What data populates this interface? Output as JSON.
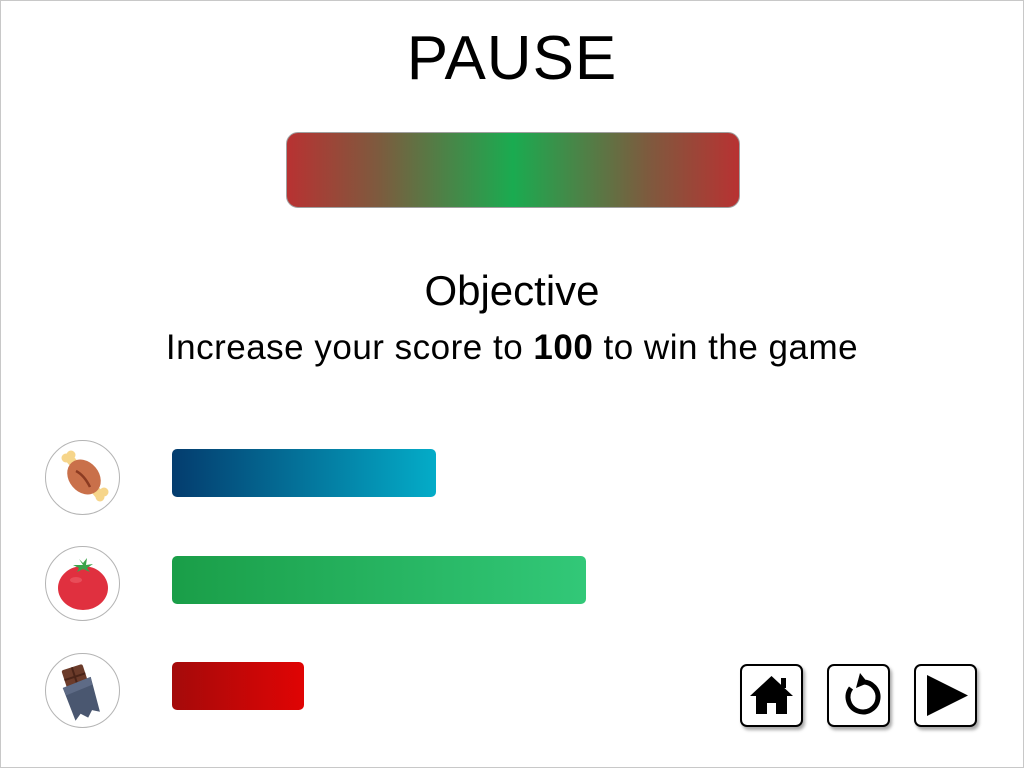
{
  "screen": {
    "title": "PAUSE"
  },
  "objective": {
    "heading": "Objective",
    "text_before": "Increase your score to ",
    "target": "100",
    "text_after": " to win the game"
  },
  "nutrients": [
    {
      "name": "meat",
      "icon": "meat-icon",
      "level": 0.44,
      "color_start": "#043c6e",
      "color_end": "#04acc8"
    },
    {
      "name": "vegetable",
      "icon": "tomato-icon",
      "level": 0.69,
      "color_start": "#1a9e48",
      "color_end": "#32c878"
    },
    {
      "name": "sweets",
      "icon": "chocolate-icon",
      "level": 0.22,
      "color_start": "#a40a0a",
      "color_end": "#e00404"
    }
  ],
  "balance_meter": {
    "colors": [
      "#b83232",
      "#1aab50",
      "#b83232"
    ]
  },
  "controls": [
    {
      "name": "home",
      "icon": "home-icon"
    },
    {
      "name": "restart",
      "icon": "restart-icon"
    },
    {
      "name": "play",
      "icon": "play-icon"
    }
  ]
}
